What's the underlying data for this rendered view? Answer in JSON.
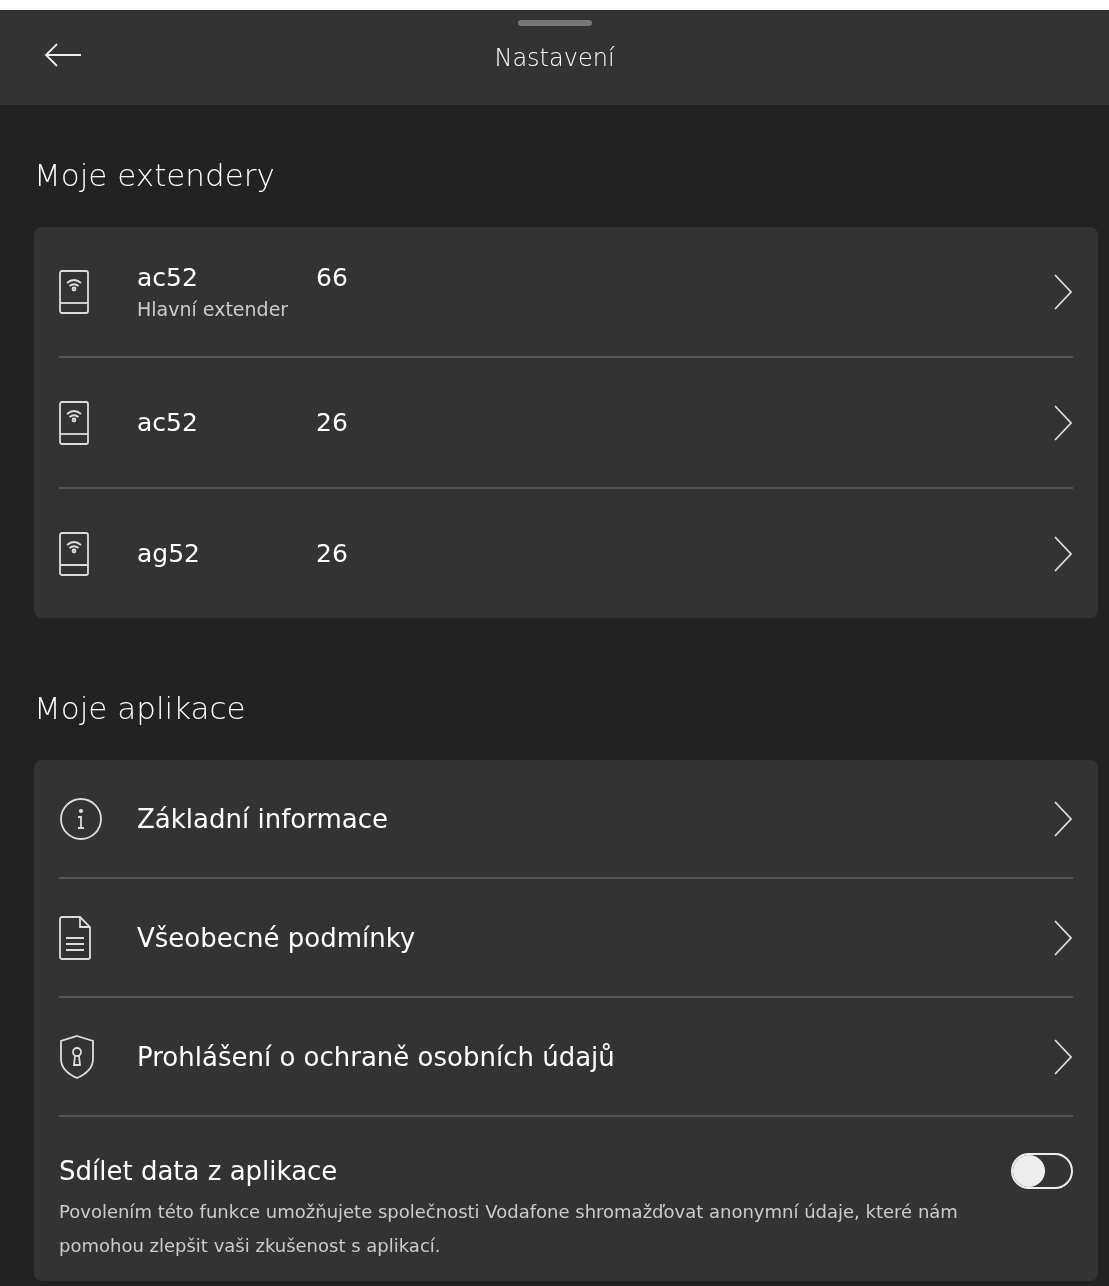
{
  "header": {
    "title": "Nastavení"
  },
  "extenders": {
    "title": "Moje extendery",
    "items": [
      {
        "name": "ac52",
        "number": "66",
        "subtitle": "Hlavní extender"
      },
      {
        "name": "ac52",
        "number": "26"
      },
      {
        "name": "ag52",
        "number": "26"
      }
    ]
  },
  "apps": {
    "title": "Moje aplikace",
    "items": [
      {
        "kind": "info",
        "label": "Základní informace"
      },
      {
        "kind": "document",
        "label": "Všeobecné podmínky"
      },
      {
        "kind": "shield",
        "label": "Prohlášení o ochraně osobních údajů"
      }
    ],
    "share": {
      "title": "Sdílet data z aplikace",
      "description": "Povolením této funkce umožňujete společnosti Vodafone shromažďovat anonymní údaje, které nám pomohou zlepšit vaši zkušenost s aplikací.",
      "on": false
    }
  }
}
